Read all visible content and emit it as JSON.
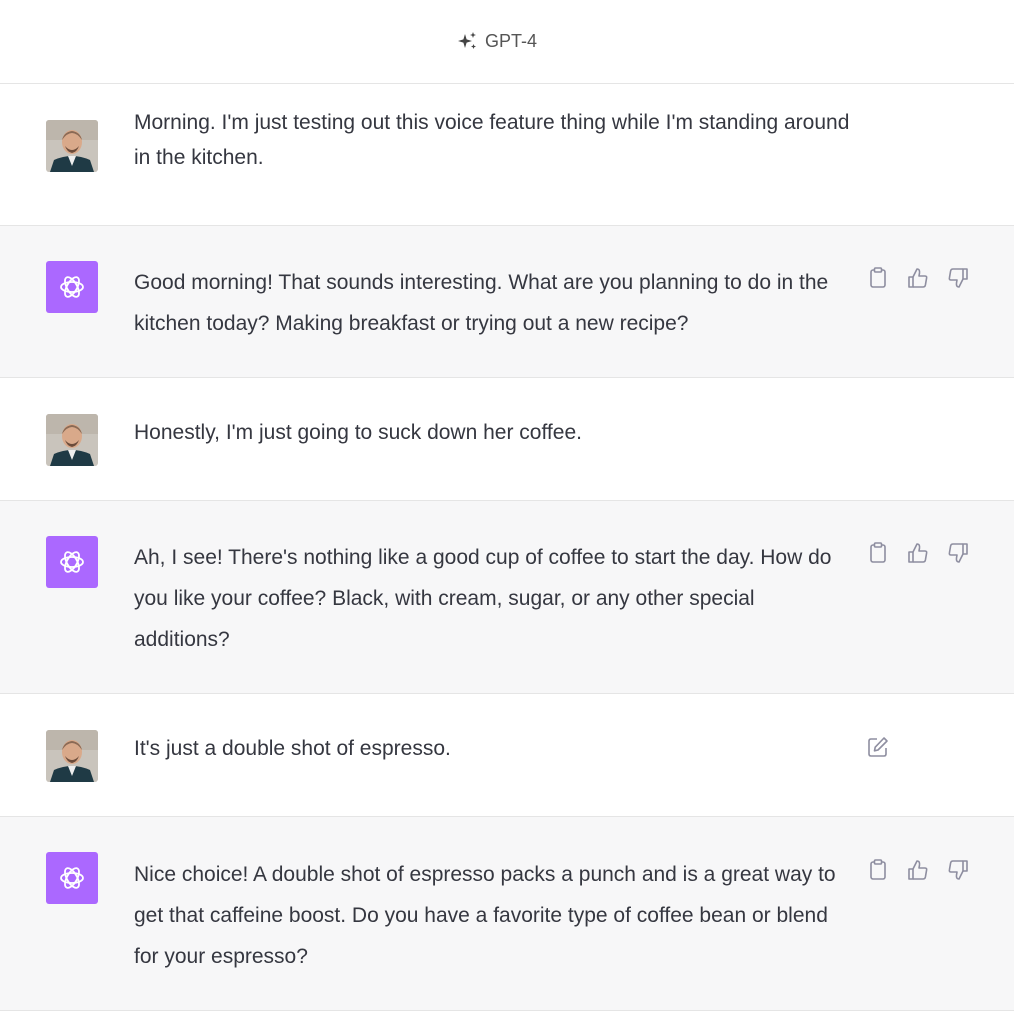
{
  "header": {
    "model_name": "GPT-4",
    "icon": "sparkle-icon"
  },
  "messages": [
    {
      "role": "user",
      "avatar": "user-avatar",
      "text": "Morning. I'm just testing out this voice feature thing while I'm standing around in the kitchen."
    },
    {
      "role": "assistant",
      "avatar": "chatgpt-logo",
      "text": "Good morning! That sounds interesting. What are you planning to do in the kitchen today? Making breakfast or trying out a new recipe?",
      "actions": [
        "copy-icon",
        "thumbs-up-icon",
        "thumbs-down-icon"
      ]
    },
    {
      "role": "user",
      "avatar": "user-avatar",
      "text": "Honestly, I'm just going to suck down her coffee."
    },
    {
      "role": "assistant",
      "avatar": "chatgpt-logo",
      "text": "Ah, I see! There's nothing like a good cup of coffee to start the day. How do you like your coffee? Black, with cream, sugar, or any other special additions?",
      "actions": [
        "copy-icon",
        "thumbs-up-icon",
        "thumbs-down-icon"
      ]
    },
    {
      "role": "user",
      "avatar": "user-avatar",
      "text": "It's just a double shot of espresso.",
      "actions": [
        "edit-icon"
      ]
    },
    {
      "role": "assistant",
      "avatar": "chatgpt-logo",
      "text": "Nice choice! A double shot of espresso packs a punch and is a great way to get that caffeine boost. Do you have a favorite type of coffee bean or blend for your espresso?",
      "actions": [
        "copy-icon",
        "thumbs-up-icon",
        "thumbs-down-icon"
      ]
    }
  ],
  "colors": {
    "assistant_bg": "#f7f7f8",
    "user_bg": "#ffffff",
    "gpt_avatar": "#ab68ff",
    "border": "#e5e5e5",
    "icon": "#8e8ea0"
  }
}
